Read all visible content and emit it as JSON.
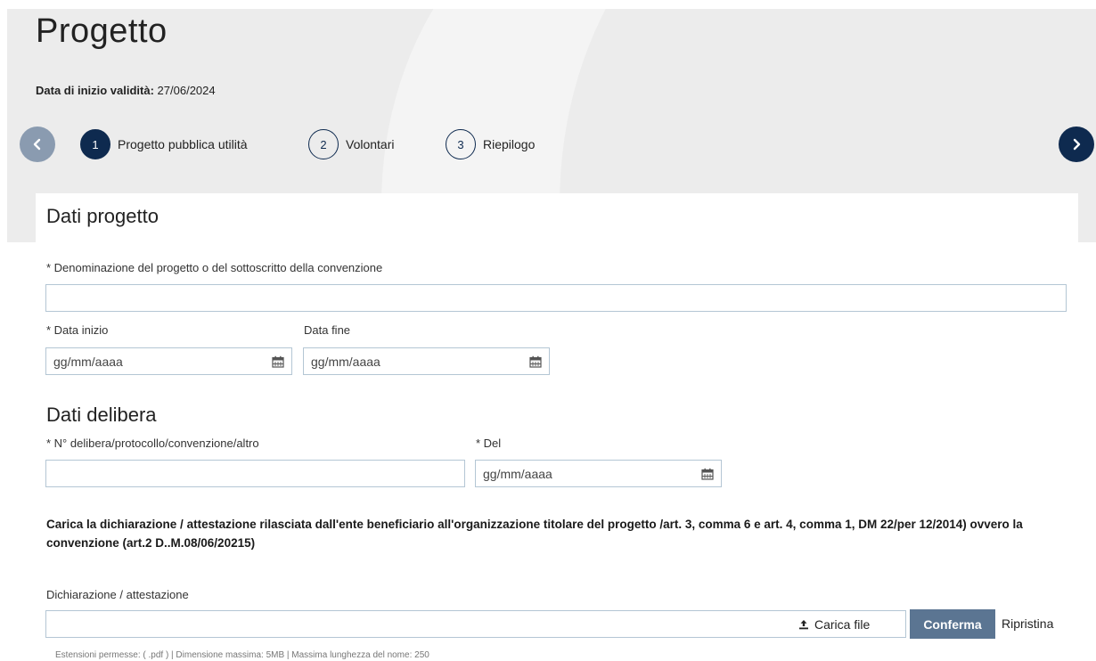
{
  "page": {
    "title": "Progetto",
    "validity_label": "Data di inizio validità:",
    "validity_date": "27/06/2024"
  },
  "stepper": {
    "steps": [
      {
        "num": "1",
        "label": "Progetto pubblica utilità",
        "active": true
      },
      {
        "num": "2",
        "label": "Volontari",
        "active": false
      },
      {
        "num": "3",
        "label": "Riepilogo",
        "active": false
      }
    ],
    "prev_icon": "chevron-left-icon",
    "next_icon": "chevron-right-icon"
  },
  "dati_progetto": {
    "title": "Dati progetto",
    "denominazione_label": "* Denominazione del progetto o del sottoscritto della convenzione",
    "denominazione_value": "",
    "data_inizio_label": "* Data inizio",
    "data_inizio_placeholder": "gg/mm/aaaa",
    "data_fine_label": "Data fine",
    "data_fine_placeholder": "gg/mm/aaaa"
  },
  "dati_delibera": {
    "title": "Dati delibera",
    "numero_label": "* N° delibera/protocollo/convenzione/altro",
    "numero_value": "",
    "del_label": "* Del",
    "del_placeholder": "gg/mm/aaaa"
  },
  "upload": {
    "instructions": "Carica la dichiarazione / attestazione rilasciata dall'ente beneficiario all'organizzazione titolare del progetto /art. 3, comma 6 e art. 4, comma 1, DM 22/per 12/2014) ovvero la convenzione (art.2 D..M.08/06/20215)",
    "field_label": "Dichiarazione / attestazione",
    "upload_label": "Carica file",
    "confirm_label": "Conferma",
    "reset_label": "Ripristina",
    "hint": "Estensioni permesse: ( .pdf ) | Dimensione massima: 5MB | Massima lunghezza del nome: 250"
  },
  "colors": {
    "primary": "#0e2a4f",
    "nav_prev": "#8a9bb0",
    "confirm": "#5b7592",
    "input_border": "#b4c6d4"
  }
}
